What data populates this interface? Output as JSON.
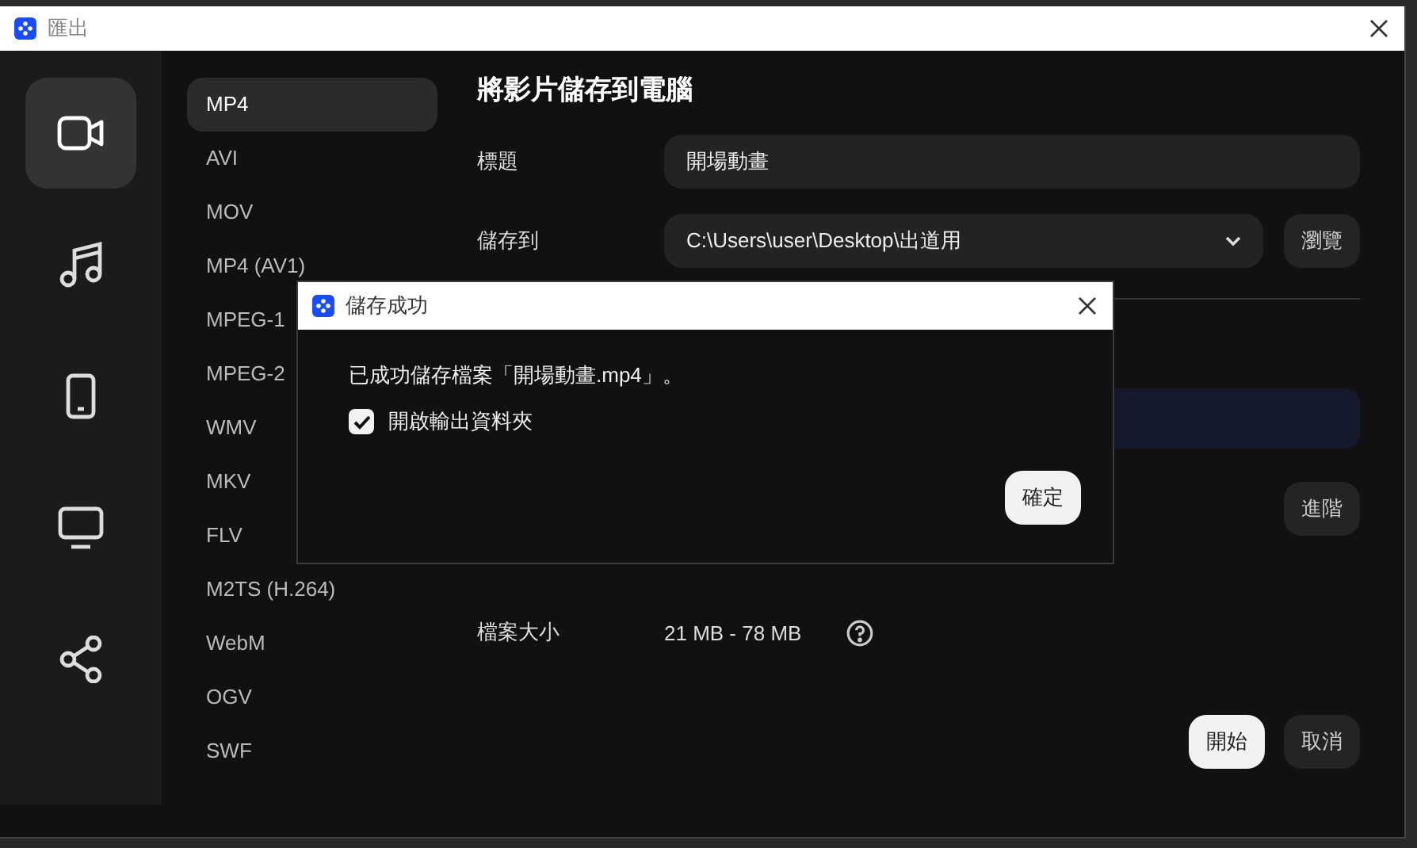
{
  "window": {
    "title": "匯出"
  },
  "sidebar": {
    "items": [
      {
        "kind": "video",
        "selected": true
      },
      {
        "kind": "music",
        "selected": false
      },
      {
        "kind": "phone",
        "selected": false
      },
      {
        "kind": "monitor",
        "selected": false
      },
      {
        "kind": "share",
        "selected": false
      }
    ]
  },
  "formats": {
    "items": [
      {
        "label": "MP4",
        "selected": true
      },
      {
        "label": "AVI",
        "selected": false
      },
      {
        "label": "MOV",
        "selected": false
      },
      {
        "label": "MP4 (AV1)",
        "selected": false
      },
      {
        "label": "MPEG-1",
        "selected": false
      },
      {
        "label": "MPEG-2",
        "selected": false
      },
      {
        "label": "WMV",
        "selected": false
      },
      {
        "label": "MKV",
        "selected": false
      },
      {
        "label": "FLV",
        "selected": false
      },
      {
        "label": "M2TS (H.264)",
        "selected": false
      },
      {
        "label": "WebM",
        "selected": false
      },
      {
        "label": "OGV",
        "selected": false
      },
      {
        "label": "SWF",
        "selected": false
      }
    ]
  },
  "main": {
    "heading": "將影片儲存到電腦",
    "title_label": "標題",
    "title_value": "開場動畫",
    "save_label": "儲存到",
    "save_value": "C:\\Users\\user\\Desktop\\出道用",
    "browse_button": "瀏覽",
    "advanced_button": "進階",
    "size_label": "檔案大小",
    "size_value": "21 MB - 78 MB",
    "start_button": "開始",
    "cancel_button": "取消"
  },
  "dialog": {
    "title": "儲存成功",
    "message": "已成功儲存檔案「開場動畫.mp4」。",
    "checkbox": {
      "label": "開啟輸出資料夾",
      "checked": true
    },
    "ok_button": "確定"
  }
}
